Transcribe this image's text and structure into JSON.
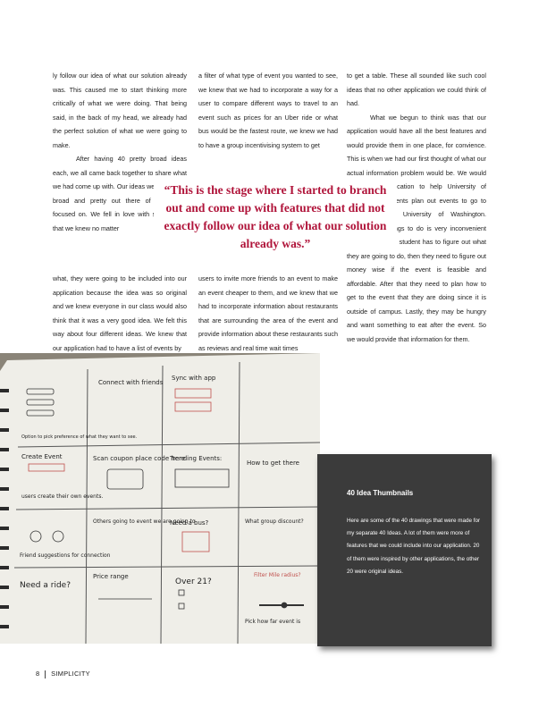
{
  "col1_top": "ly follow our idea of what our solution already was. This caused me to start thinking more critically of what we were doing. That being said, in the back of my head, we already had the perfect solution of what we were going to make.",
  "col1_indent": "After having 40 pretty broad ideas each, we all came back together to share what we had come up with. Our ideas were all pretty broad and pretty out there of what they focused on. We fell in love with some ideas that we knew no matter",
  "col1_bottom": "what, they were going to be included into our application because the idea was so original and we knew everyone in our class would also think that it was a very good idea. We felt this way about four different ideas. We knew that our application had to have a list of events by",
  "col2_top": "a filter of what type of event you wanted to see, we knew that we had to incorporate a way for a user to compare different ways to travel to an event such as prices for an Uber ride or what bus would be the fastest route, we knew we had to have a group incentivising system to get",
  "col2_bottom": "users to invite more friends to an event to make an event cheaper to them, and we knew that we had to incorporate information about restaurants that are surrounding the area of the event and provide information about these restaurants such as reviews and real time wait times",
  "col3_top": "to get a table. These all sounded like such cool ideas that no other application we could think of had.",
  "col3_indent": "What we begun to think was that our application would have all the best features and would provide them in one place, for convience. This is when we had our first thought of what our actual information problem would be. We would design an application to help University of Washington students plan out events to go to outside of the University of Washington. Planning out things to do is very inconvenient because first, the student has to figure out what they are going to do, then they need to figure out money wise if the event is feasible and affordable. After that they need to plan how to get to the event that they are doing since it is outside of campus. Lastly, they may be hungry and want something to eat after the event. So we would provide that information for them.",
  "pull_quote": "“This is the stage where I started to branch out and come up with features that did not exactly follow our idea of what our solution already was.”",
  "sidebar": {
    "title": "40 Idea Thumbnails",
    "text": "Here are some of the 40 drawings that were made for my separate 40 Ideas. A lot of them were more of features that we could include into our application. 20 of them were inspired by other applications, the other 20 were original ideas."
  },
  "sketch": {
    "cells": [
      "Connect with friends",
      "Sync with app",
      "Option to pick preference of what they want to see.",
      "Create Event",
      "Scan coupon place code here",
      "Trending Events:",
      "How to get there",
      "users create their own events.",
      "Friend suggestions for connection",
      "Others going to event we are going to",
      "Need a bus?",
      "What group discount?",
      "Need a ride?",
      "Price range",
      "Over 21?",
      "Filter Mile radius?",
      "Pick how far event is"
    ]
  },
  "footer": {
    "page_number": "8",
    "publication": "SIMPLICITY"
  },
  "colors": {
    "accent": "#b0143a",
    "sidebar_bg": "#3b3b3b"
  }
}
